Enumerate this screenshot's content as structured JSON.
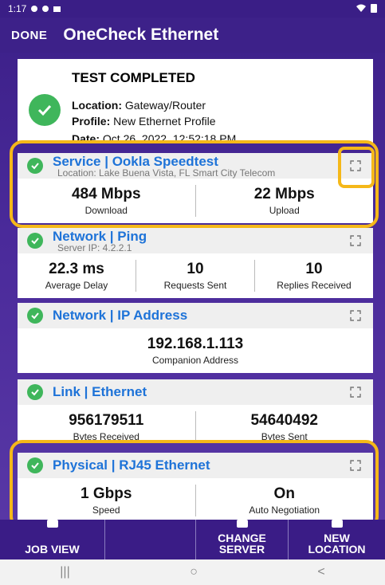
{
  "status_bar": {
    "time": "1:17"
  },
  "app_bar": {
    "done_label": "DONE",
    "title": "OneCheck Ethernet"
  },
  "summary": {
    "heading": "TEST COMPLETED",
    "location_label": "Location:",
    "location_value": "Gateway/Router",
    "profile_label": "Profile:",
    "profile_value": "New Ethernet Profile",
    "date_label": "Date:",
    "date_value": "Oct 26, 2022, 12:52:18 PM"
  },
  "cards": [
    {
      "title": "Service | Ookla Speedtest",
      "subtitle": "Location: Lake Buena Vista, FL Smart City Telecom",
      "metrics": [
        {
          "value": "484 Mbps",
          "label": "Download"
        },
        {
          "value": "22 Mbps",
          "label": "Upload"
        }
      ]
    },
    {
      "title": "Network | Ping",
      "subtitle": "Server IP: 4.2.2.1",
      "metrics": [
        {
          "value": "22.3 ms",
          "label": "Average Delay"
        },
        {
          "value": "10",
          "label": "Requests Sent"
        },
        {
          "value": "10",
          "label": "Replies Received"
        }
      ]
    },
    {
      "title": "Network | IP Address",
      "metrics": [
        {
          "value": "192.168.1.113",
          "label": "Companion Address"
        }
      ]
    },
    {
      "title": "Link | Ethernet",
      "metrics": [
        {
          "value": "956179511",
          "label": "Bytes Received"
        },
        {
          "value": "54640492",
          "label": "Bytes Sent"
        }
      ]
    },
    {
      "title": "Physical | RJ45 Ethernet",
      "metrics": [
        {
          "value": "1 Gbps",
          "label": "Speed"
        },
        {
          "value": "On",
          "label": "Auto Negotiation"
        }
      ]
    }
  ],
  "toolbar": {
    "job_view": "JOB VIEW",
    "change_server_1": "CHANGE",
    "change_server_2": "SERVER",
    "new_location_1": "NEW",
    "new_location_2": "LOCATION"
  },
  "nav": {
    "recent": "|||",
    "home": "○",
    "back": "<"
  },
  "colors": {
    "accent": "#3d2189",
    "highlight": "#f5b819",
    "success": "#3fb65b",
    "link": "#1e73d8"
  }
}
